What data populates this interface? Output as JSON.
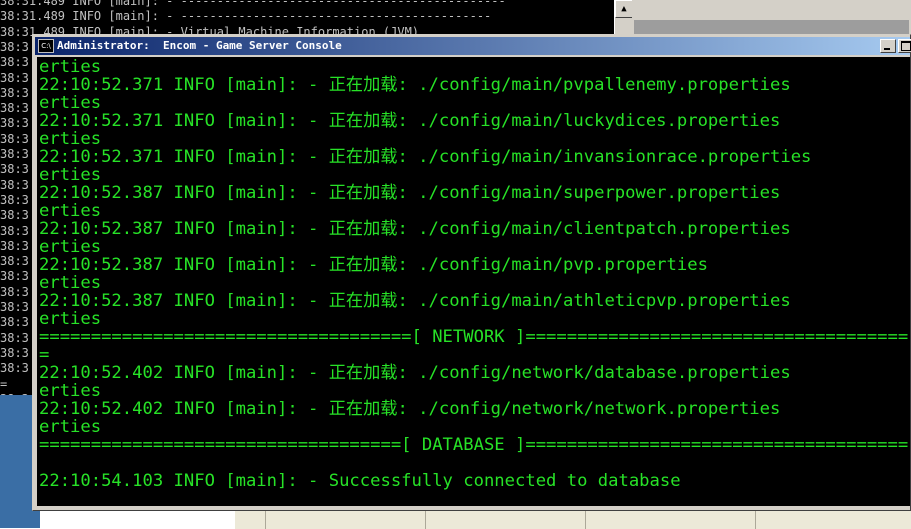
{
  "background_console": {
    "lines": [
      "38:31.489 INFO [main]: - ---------------------------------------------",
      "38:31.489 INFO [main]: - -------------------------------------------",
      "38:31.489 INFO [main]: - Virtual Machine Information (JVM)",
      "38:3",
      "38:3",
      "38:3",
      "38:3",
      "38:3",
      "38:3",
      "38:3",
      "38:3",
      "38:3",
      "38:3",
      "38:3",
      "38:3",
      "38:3",
      "38:3",
      "38:3",
      "38:3",
      "38:3",
      "38:3",
      "38:3",
      "38:3",
      "38:3",
      "38:3",
      "=",
      "38:3"
    ]
  },
  "window": {
    "title": "Administrator:  Encom - Game Server Console",
    "icon_label": "C:\\"
  },
  "console": {
    "lines": [
      "erties",
      "22:10:52.371 INFO [main]: - 正在加载: ./config/main/pvpallenemy.properties",
      "erties",
      "22:10:52.371 INFO [main]: - 正在加载: ./config/main/luckydices.properties",
      "erties",
      "22:10:52.371 INFO [main]: - 正在加载: ./config/main/invansionrace.properties",
      "erties",
      "22:10:52.387 INFO [main]: - 正在加载: ./config/main/superpower.properties",
      "erties",
      "22:10:52.387 INFO [main]: - 正在加载: ./config/main/clientpatch.properties",
      "erties",
      "22:10:52.387 INFO [main]: - 正在加载: ./config/main/pvp.properties",
      "erties",
      "22:10:52.387 INFO [main]: - 正在加载: ./config/main/athleticpvp.properties",
      "erties",
      "====================================[ NETWORK ]=====================================",
      "=",
      "22:10:52.402 INFO [main]: - 正在加载: ./config/network/database.properties",
      "erties",
      "22:10:52.402 INFO [main]: - 正在加载: ./config/network/network.properties",
      "erties",
      "===================================[ DATABASE ]=====================================",
      "",
      "22:10:54.103 INFO [main]: - Successfully connected to database"
    ]
  },
  "colors": {
    "console_text": "#27e227",
    "console_bg": "#000000",
    "title_active": "#0a246a"
  }
}
